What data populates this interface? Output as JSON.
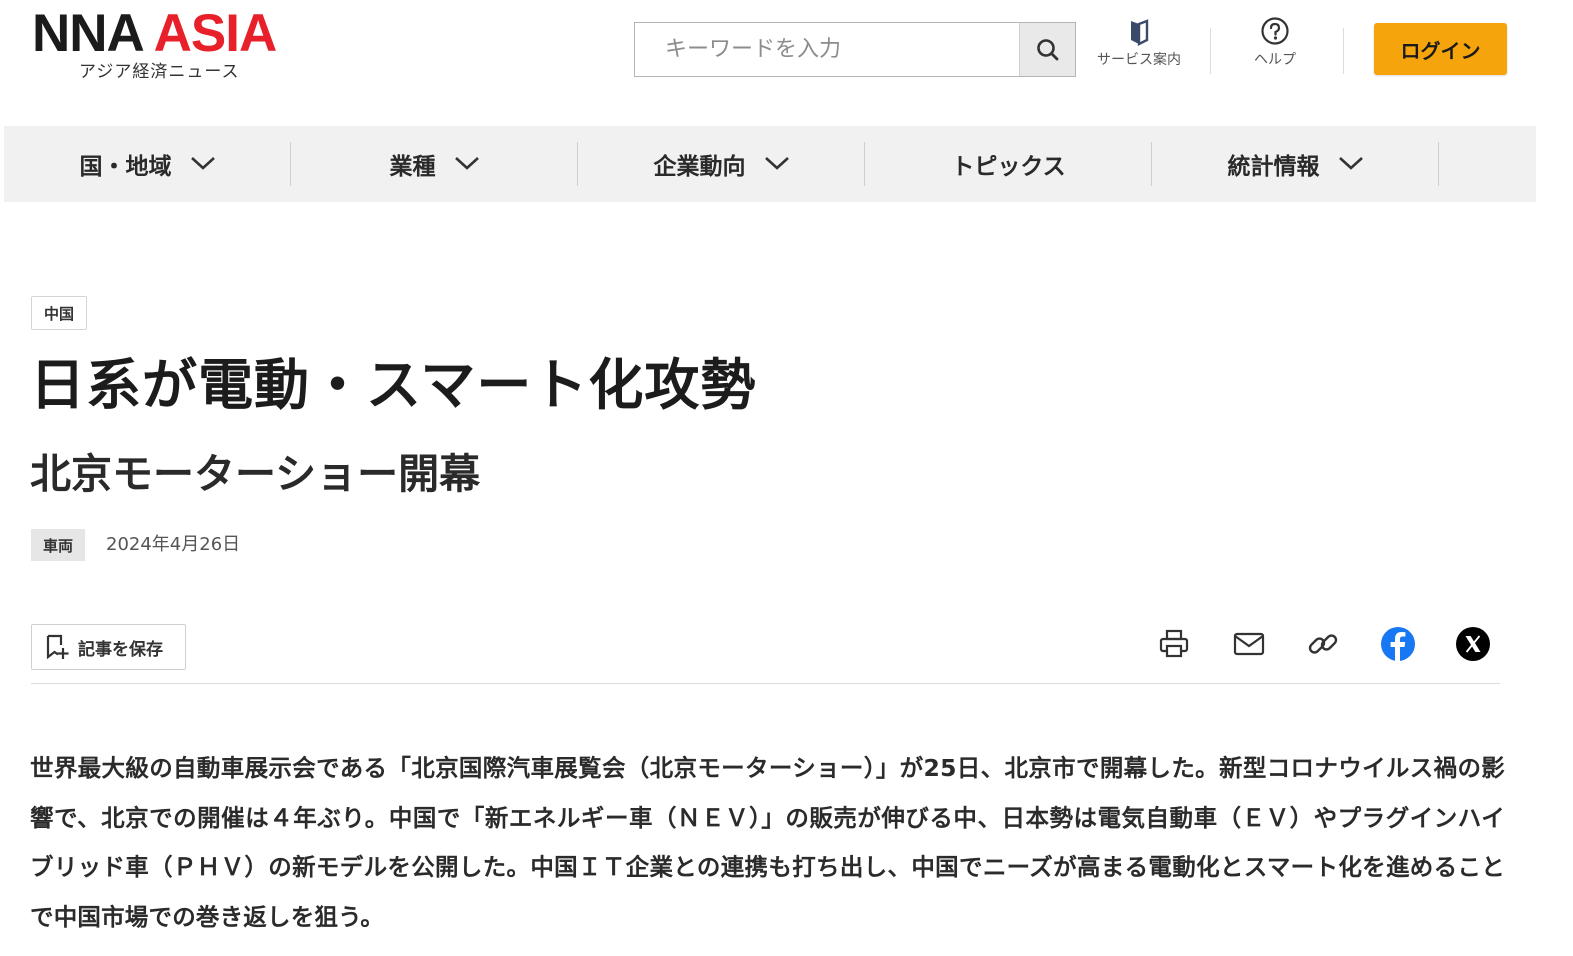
{
  "header": {
    "logo_nna": "NNA",
    "logo_asia": "ASIA",
    "logo_sub": "アジア経済ニュース",
    "search_placeholder": "キーワードを入力",
    "service_label": "サービス案内",
    "help_label": "ヘルプ",
    "login_label": "ログイン"
  },
  "nav": {
    "items": [
      {
        "label": "国・地域",
        "dropdown": true
      },
      {
        "label": "業種",
        "dropdown": true
      },
      {
        "label": "企業動向",
        "dropdown": true
      },
      {
        "label": "トピックス",
        "dropdown": false
      },
      {
        "label": "統計情報",
        "dropdown": true
      }
    ]
  },
  "article": {
    "region": "中国",
    "title": "日系が電動・スマート化攻勢",
    "subtitle": "北京モーターショー開幕",
    "category": "車両",
    "date": "2024年4月26日",
    "save_label": "記事を保存",
    "lead": "世界最大級の自動車展示会である「北京国際汽車展覧会（北京モーターショー）」が25日、北京市で開幕した。新型コロナウイルス禍の影響で、北京での開催は４年ぶり。中国で「新エネルギー車（ＮＥＶ）」の販売が伸びる中、日本勢は電気自動車（ＥＶ）やプラグインハイブリッド車（ＰＨＶ）の新モデルを公開した。中国ＩＴ企業との連携も打ち出し、中国でニーズが高まる電動化とスマート化を進めることで中国市場での巻き返しを狙う。"
  },
  "colors": {
    "brand_red": "#e8202a",
    "login_orange": "#f5a40c",
    "facebook_blue": "#1877f2",
    "x_black": "#000000",
    "nav_bg": "#f1f1f1"
  },
  "share_icons": [
    "print-icon",
    "mail-icon",
    "link-icon",
    "facebook-icon",
    "x-icon"
  ]
}
